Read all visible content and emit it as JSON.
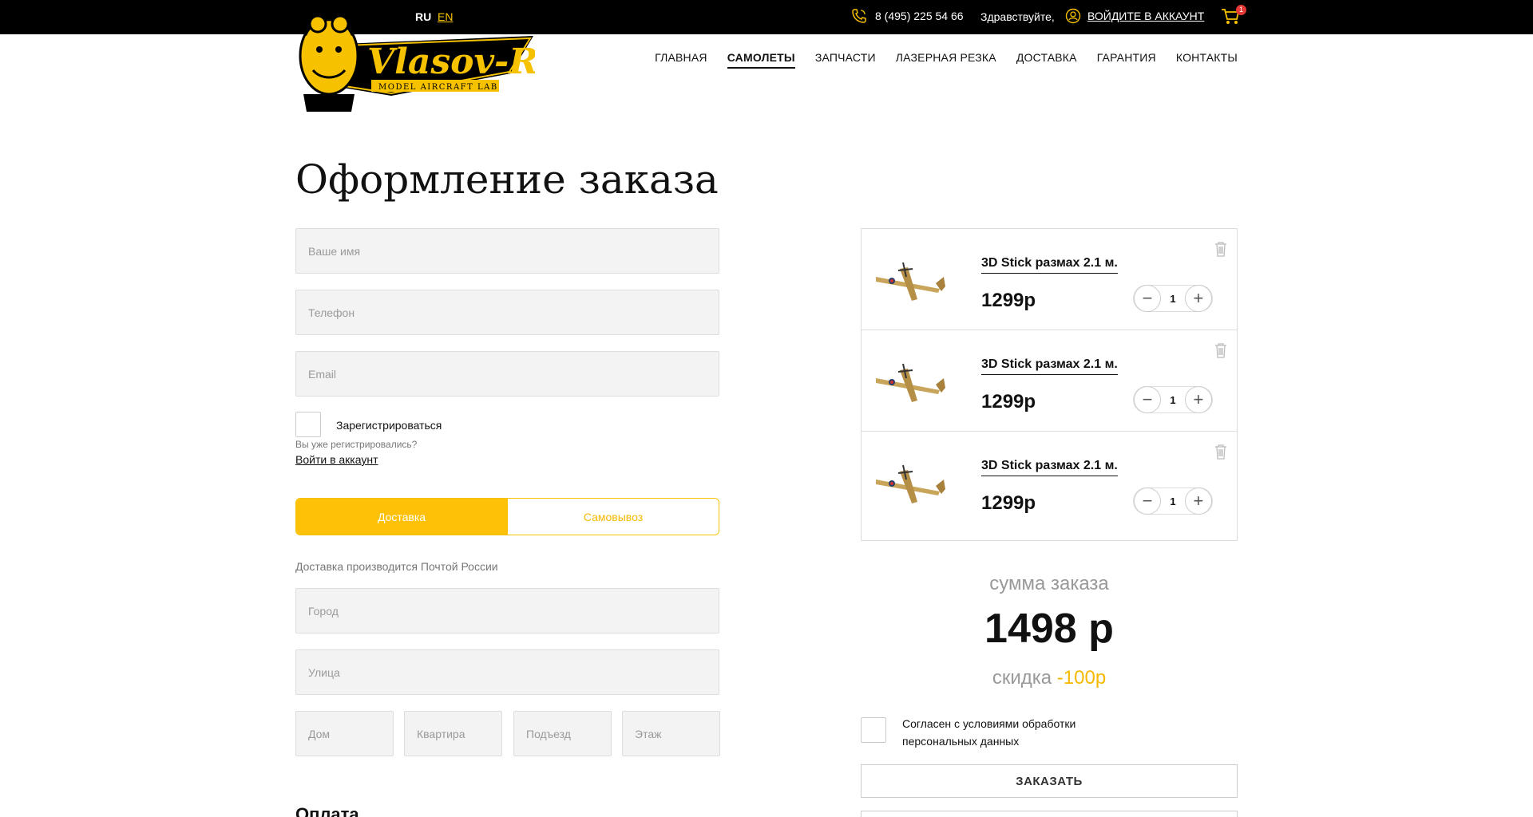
{
  "topbar": {
    "lang_ru": "RU",
    "lang_en": "EN",
    "phone": "8 (495) 225 54 66",
    "greeting": "Здравствуйте,",
    "login": "ВОЙДИТЕ В АККАУНТ",
    "cart_count": "1"
  },
  "logo": {
    "name": "Vlasov-RC",
    "tagline": "MODEL AIRCRAFT LAB"
  },
  "nav": {
    "items": [
      "ГЛАВНАЯ",
      "САМОЛЕТЫ",
      "ЗАПЧАСТИ",
      "ЛАЗЕРНАЯ РЕЗКА",
      "ДОСТАВКА",
      "ГАРАНТИЯ",
      "КОНТАКТЫ"
    ],
    "active": "САМОЛЕТЫ"
  },
  "page_title": "Оформление заказа",
  "form": {
    "name_placeholder": "Ваше имя",
    "phone_placeholder": "Телефон",
    "email_placeholder": "Email",
    "register_label": "Зарегистрироваться",
    "already_registered": "Вы уже регистрировались?",
    "login_link": "Войти в аккаунт",
    "delivery_tab": "Доставка",
    "pickup_tab": "Самовывоз",
    "delivery_note": "Доставка производится Почтой России",
    "city_placeholder": "Город",
    "street_placeholder": "Улица",
    "house_placeholder": "Дом",
    "apartment_placeholder": "Квартира",
    "entrance_placeholder": "Подъезд",
    "floor_placeholder": "Этаж",
    "payment_title": "Оплата"
  },
  "cart": {
    "items": [
      {
        "name": "3D Stick размах 2.1 м.",
        "price": "1299р",
        "qty": "1"
      },
      {
        "name": "3D Stick размах 2.1 м.",
        "price": "1299р",
        "qty": "1"
      },
      {
        "name": "3D Stick размах 2.1 м.",
        "price": "1299р",
        "qty": "1"
      }
    ],
    "sum_label": "сумма заказа",
    "sum_value": "1498 р",
    "discount_label": "скидка",
    "discount_value": "-100р",
    "agree_text": "Согласен с условиями обработки персональных данных",
    "order_button": "ЗАКАЗАТЬ"
  },
  "colors": {
    "accent": "#ffc107",
    "topbar": "#000000",
    "badge": "#e53935"
  }
}
